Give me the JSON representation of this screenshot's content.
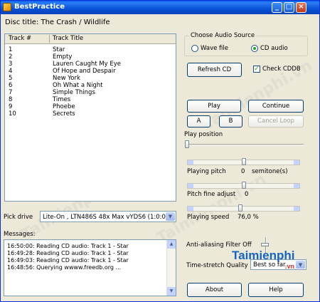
{
  "window": {
    "title": "BestPractice",
    "controls": [
      "_",
      "□",
      "×"
    ]
  },
  "disc_title": "Disc title: The Crash / Wildlife",
  "tracks": {
    "headers": [
      "Track #",
      "Track Title"
    ],
    "rows": [
      {
        "n": "1",
        "title": "Star"
      },
      {
        "n": "2",
        "title": "Empty"
      },
      {
        "n": "3",
        "title": "Lauren Caught My Eye"
      },
      {
        "n": "4",
        "title": "Of Hope and Despair"
      },
      {
        "n": "5",
        "title": "New York"
      },
      {
        "n": "6",
        "title": "Oh What a Night"
      },
      {
        "n": "7",
        "title": "Simple Things"
      },
      {
        "n": "8",
        "title": "Times"
      },
      {
        "n": "9",
        "title": "Phoebe"
      },
      {
        "n": "10",
        "title": "Secrets"
      }
    ]
  },
  "source": {
    "group_title": "Choose Audio Source",
    "wave_label": "Wave file",
    "cd_label": "CD audio",
    "selected": "CD audio"
  },
  "refresh_label": "Refresh CD",
  "check_cddb": {
    "label": "Check CDDB",
    "checked": true
  },
  "buttons": {
    "play": "Play",
    "continue": "Continue",
    "a": "A",
    "b": "B",
    "cancel_loop": "Cancel Loop",
    "about": "About",
    "help": "Help"
  },
  "sliders": {
    "play_position": {
      "label": "Play position",
      "value": 0
    },
    "pitch": {
      "label": "Playing pitch",
      "value": "0",
      "unit": "semitone(s)"
    },
    "fine": {
      "label": "Pitch fine adjust",
      "value": "0"
    },
    "speed": {
      "label": "Playing speed",
      "value": "76,0 %"
    }
  },
  "antialias": {
    "label": "Anti-aliasing Filter Off"
  },
  "timestretch": {
    "label": "Time-stretch Quality",
    "value": "Best so far..."
  },
  "pick_drive": {
    "label": "Pick drive",
    "value": "Lite-On , LTN486S 48x Max  vYDS6 (1:0:0)"
  },
  "messages": {
    "label": "Messages:",
    "lines": [
      "16:50:00: Reading CD audio: Track 1 - Star",
      "16:49:28: Reading CD audio: Track 1 - Star",
      "16:49:03: Reading CD audio: Track 1 - Star",
      "16:48:56: Querying wwww.freedb.org ..."
    ]
  },
  "logo": {
    "text_main": "Taimienphi",
    "text_sub": ".vn"
  },
  "watermarks": [
    "Taimienphi.vn",
    "Taimienphi.vn",
    "Taimienphi.vn",
    "Taimienphi.vn"
  ],
  "colors": {
    "titlebar": "#0a5fe8",
    "window_bg": "#ece9d8",
    "selected_radio": "#21a121",
    "logo_blue": "#1565c0",
    "logo_red": "#d32f2f"
  }
}
